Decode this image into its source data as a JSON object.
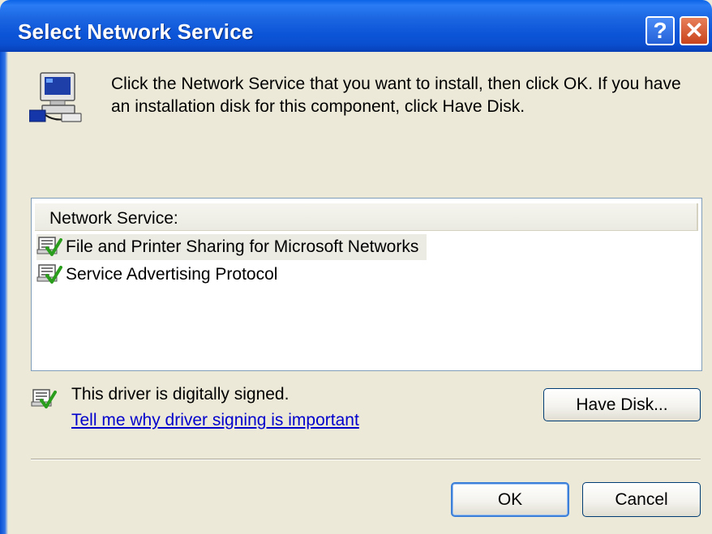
{
  "window": {
    "title": "Select Network Service",
    "help_glyph": "?",
    "close_glyph": "✕"
  },
  "instruction": "Click the Network Service that you want to install, then click OK. If you have an installation disk for this component, click Have Disk.",
  "list": {
    "header": "Network Service:",
    "items": [
      {
        "label": "File and Printer Sharing for Microsoft Networks",
        "icon": "signed-driver-icon",
        "selected": true
      },
      {
        "label": "Service Advertising Protocol",
        "icon": "signed-driver-icon",
        "selected": false
      }
    ]
  },
  "signature": {
    "status_text": "This driver is digitally signed.",
    "link_text": "Tell me why driver signing is important"
  },
  "buttons": {
    "have_disk": "Have Disk...",
    "ok": "OK",
    "cancel": "Cancel"
  },
  "colors": {
    "titlebar": "#0a55d8",
    "dialog_bg": "#ece9d8",
    "link": "#0000cc",
    "close_button": "#c9441c"
  }
}
